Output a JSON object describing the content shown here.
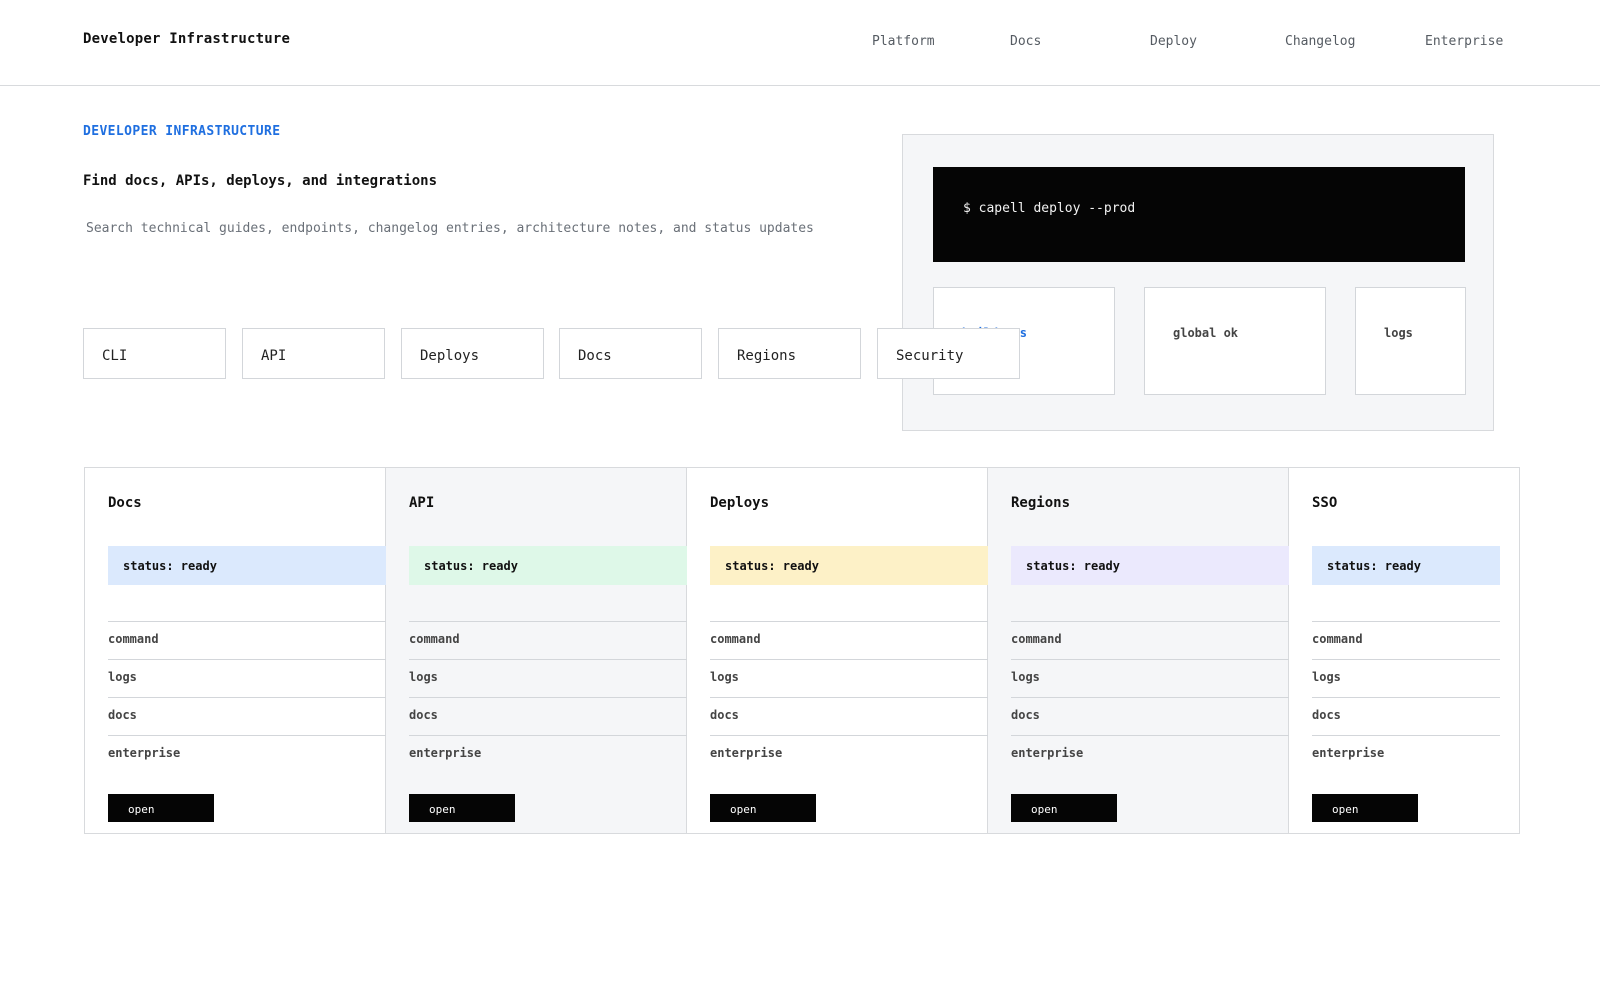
{
  "header": {
    "brand": "Developer Infrastructure",
    "nav": [
      "Platform",
      "Docs",
      "Deploy",
      "Changelog",
      "Enterprise"
    ]
  },
  "hero": {
    "eyebrow": "DEVELOPER INFRASTRUCTURE",
    "headline": "Find docs, APIs, deploys, and integrations",
    "subline": "Search technical guides, endpoints, changelog entries, architecture notes, and status updates",
    "chips": [
      "CLI",
      "API",
      "Deploys",
      "Docs",
      "Regions",
      "Security"
    ]
  },
  "preview": {
    "command": "$ capell deploy --prod",
    "tiles": [
      "build 42s",
      "global ok",
      "logs"
    ]
  },
  "colors": {
    "accent": "#1f6fe0",
    "status_blue": "#dbe9fd",
    "status_green": "#def8e8",
    "status_yellow": "#fdf1c7",
    "status_violet": "#ebe9fd"
  },
  "cards": [
    {
      "title": "Docs",
      "status": "status: ready",
      "rows": [
        "command",
        "logs",
        "docs",
        "enterprise"
      ],
      "action": "open"
    },
    {
      "title": "API",
      "status": "status: ready",
      "rows": [
        "command",
        "logs",
        "docs",
        "enterprise"
      ],
      "action": "open"
    },
    {
      "title": "Deploys",
      "status": "status: ready",
      "rows": [
        "command",
        "logs",
        "docs",
        "enterprise"
      ],
      "action": "open"
    },
    {
      "title": "Regions",
      "status": "status: ready",
      "rows": [
        "command",
        "logs",
        "docs",
        "enterprise"
      ],
      "action": "open"
    },
    {
      "title": "SSO",
      "status": "status: ready",
      "rows": [
        "command",
        "logs",
        "docs",
        "enterprise"
      ],
      "action": "open"
    }
  ]
}
